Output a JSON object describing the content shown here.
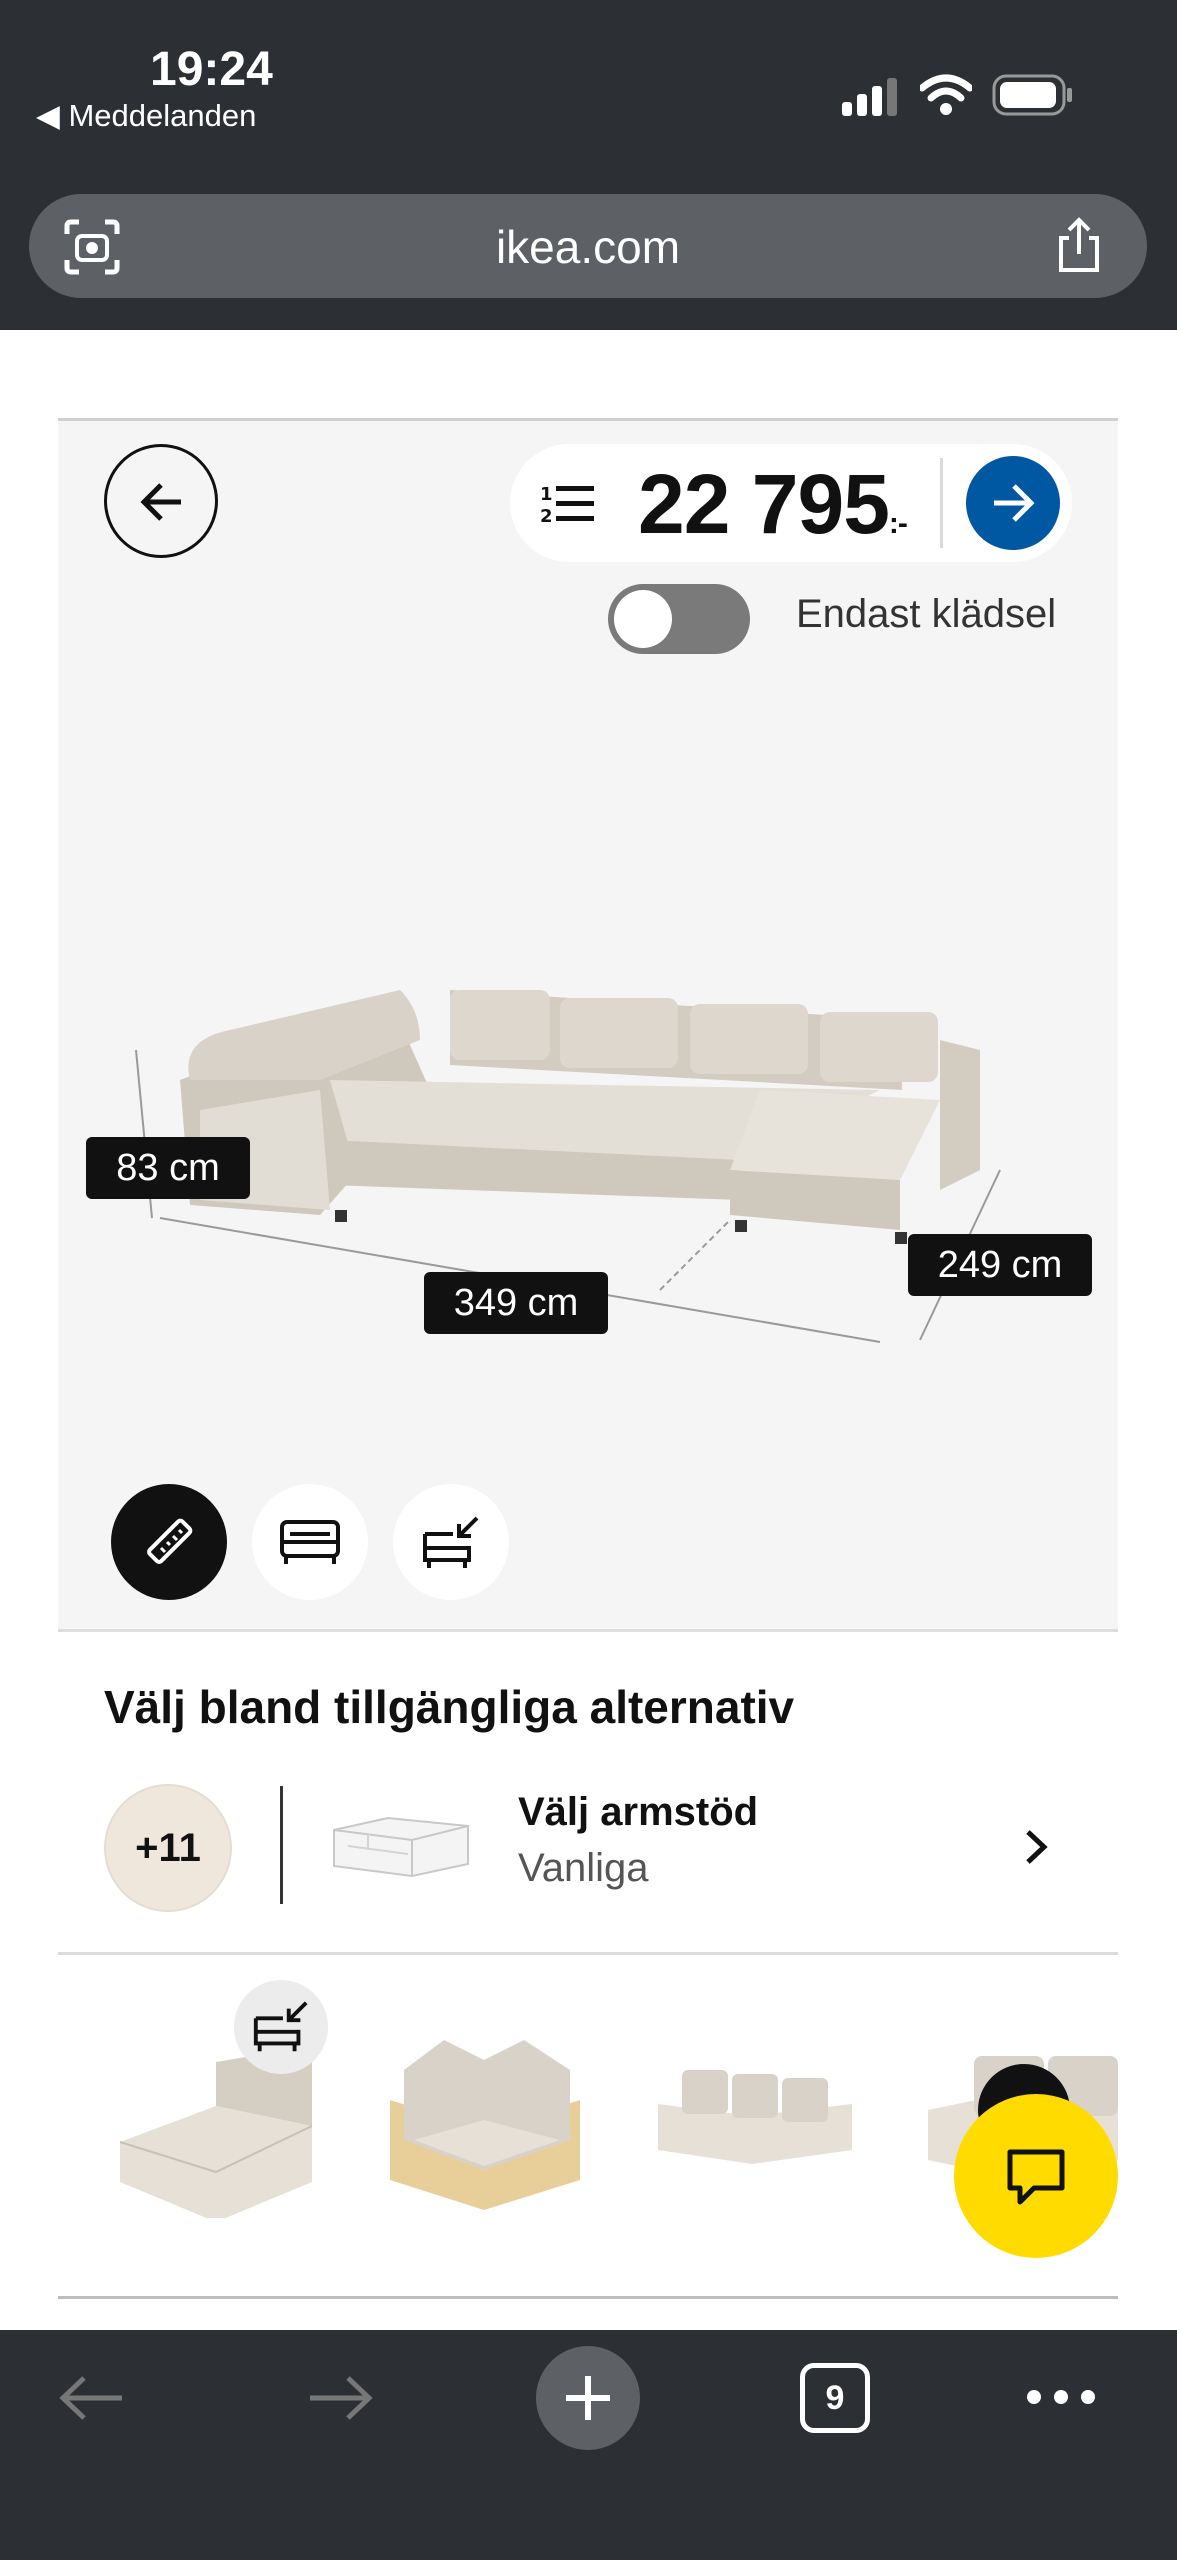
{
  "status_bar": {
    "time": "19:24",
    "back_app": "◀ Meddelanden"
  },
  "browser": {
    "url": "ikea.com",
    "tab_count": "9"
  },
  "configurator": {
    "price": "22 795",
    "price_suffix": ":-",
    "toggle_label": "Endast klädsel",
    "toggle_on": false,
    "dimensions": {
      "height": "83 cm",
      "width": "349 cm",
      "depth": "249 cm"
    }
  },
  "options": {
    "section_title": "Välj bland tillgängliga alternativ",
    "more_badge": "+11",
    "armrest_title": "Välj armstöd",
    "armrest_value": "Vanliga"
  },
  "colors": {
    "brand_blue": "#0058a3",
    "chat_yellow": "#ffdb00",
    "sofa_beige": "#d8d2c8"
  }
}
